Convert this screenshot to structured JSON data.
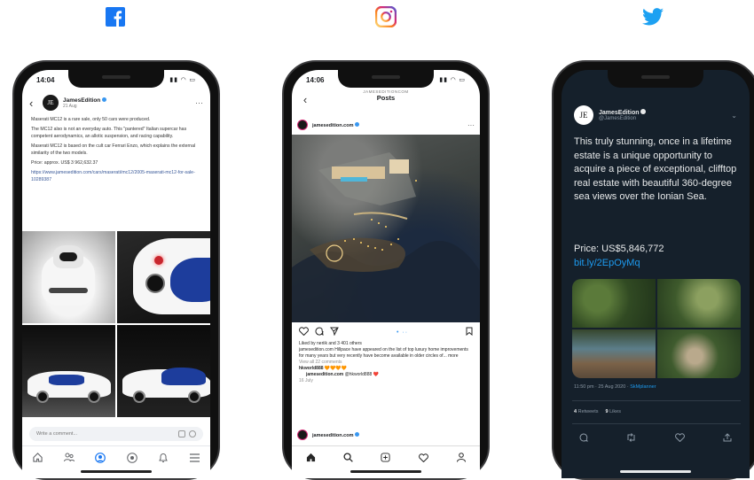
{
  "brands": {
    "facebook": {
      "icon": "facebook-icon",
      "color": "#1877f2"
    },
    "instagram": {
      "icon": "instagram-icon",
      "color": "#e1306c"
    },
    "twitter": {
      "icon": "twitter-icon",
      "color": "#1da1f2"
    }
  },
  "facebook": {
    "time": "14:04",
    "back": "‹",
    "avatar_text": "JE",
    "page_name": "JamesEdition",
    "post_date": "21 Aug",
    "more": "···",
    "paragraphs": [
      "Maserati MC12 is a rare sale, only 50 cars were produced.",
      "The MC12 also is not an everyday auto. This \"pantered\" Italian supercar has competent aerodynamics, an allotic suspension, and racing capability.",
      "Maserati MC12 is based on the cult car Ferrari Enzo, which explains the external similarity of the two models.",
      "Price: approx. US$ 3 962,632.37"
    ],
    "link": "https://www.jamesedition.com/cars/maserati/mc12/2005-maserati-mc12-for-sale-10289387",
    "comment_placeholder": "Write a comment..."
  },
  "instagram": {
    "time": "14:06",
    "back": "‹",
    "account_caption": "JAMESEDITIONCOM",
    "title": "Posts",
    "username": "jamesedition.com",
    "more": "···",
    "likes": "Liked by neriik and 3 401 others",
    "caption": "jamesedition.com Hillpace have appeared on the list of top luxury home improvements for many years but very recently have become available in older circles of... more",
    "view_comments": "View all 22 comments",
    "comment1_user": "hkworld888",
    "comment1_text": "🧡🧡🧡🧡",
    "comment2_user": "jamesedition.com",
    "comment2_text": "@hkworld888 ❤️",
    "date": "16 July",
    "next_user": "jamesedition.com"
  },
  "twitter": {
    "avatar_text": "JE",
    "name": "JamesEdition",
    "handle": "@JamesEdition",
    "body": "This truly stunning, once in a lifetime estate is a unique opportunity to acquire a piece of exceptional, clifftop real estate with beautiful 360-degree sea views over the Ionian Sea.",
    "price": "Price: US$5,846,772",
    "link": "bit.ly/2EpOyMq",
    "meta_prefix": "11:50 pm · 25 Aug 2020 · ",
    "meta_source": "SkMplanner",
    "retweets_label": "Retweets",
    "likes_label": "Likes",
    "retweets_count": "4",
    "likes_count": "9"
  }
}
